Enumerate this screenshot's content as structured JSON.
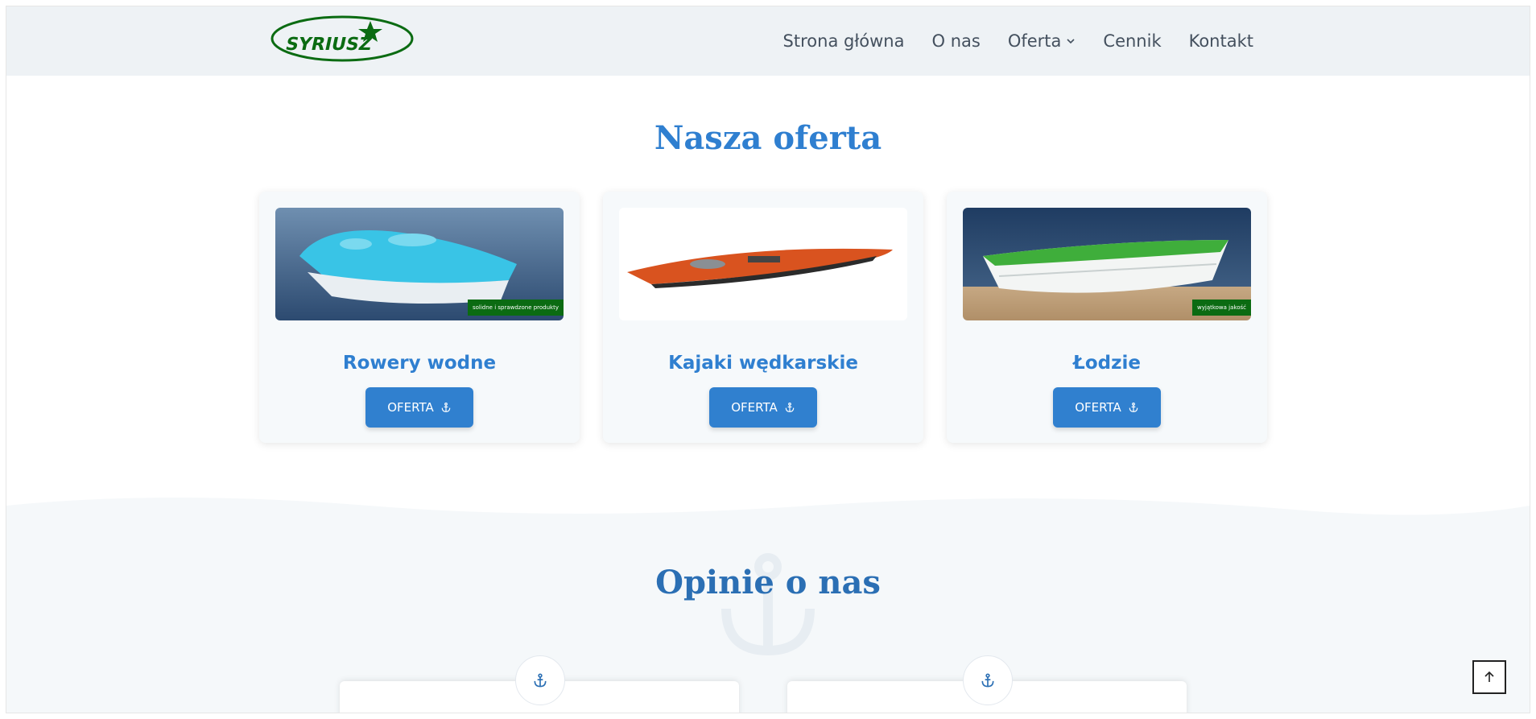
{
  "header": {
    "logo_text": "SYRIUSZ",
    "nav": [
      {
        "label": "Strona główna"
      },
      {
        "label": "O nas"
      },
      {
        "label": "Oferta",
        "has_dropdown": true
      },
      {
        "label": "Cennik"
      },
      {
        "label": "Kontakt"
      }
    ]
  },
  "offer": {
    "title": "Nasza oferta",
    "cards": [
      {
        "title": "Rowery wodne",
        "button": "OFERTA",
        "badge": "solidne i sprawdzone produkty"
      },
      {
        "title": "Kajaki wędkarskie",
        "button": "OFERTA",
        "badge": ""
      },
      {
        "title": "Łodzie",
        "button": "OFERTA",
        "badge": "wyjątkowa jakość"
      }
    ]
  },
  "opinions": {
    "title": "Opinie o nas"
  },
  "colors": {
    "primary": "#2f7fd0",
    "header_bg": "#eef2f5",
    "logo_green": "#0b6b12"
  },
  "icons": {
    "anchor": "anchor-icon",
    "dropdown": "chevron-down-icon",
    "scroll_top": "arrow-up-icon"
  }
}
